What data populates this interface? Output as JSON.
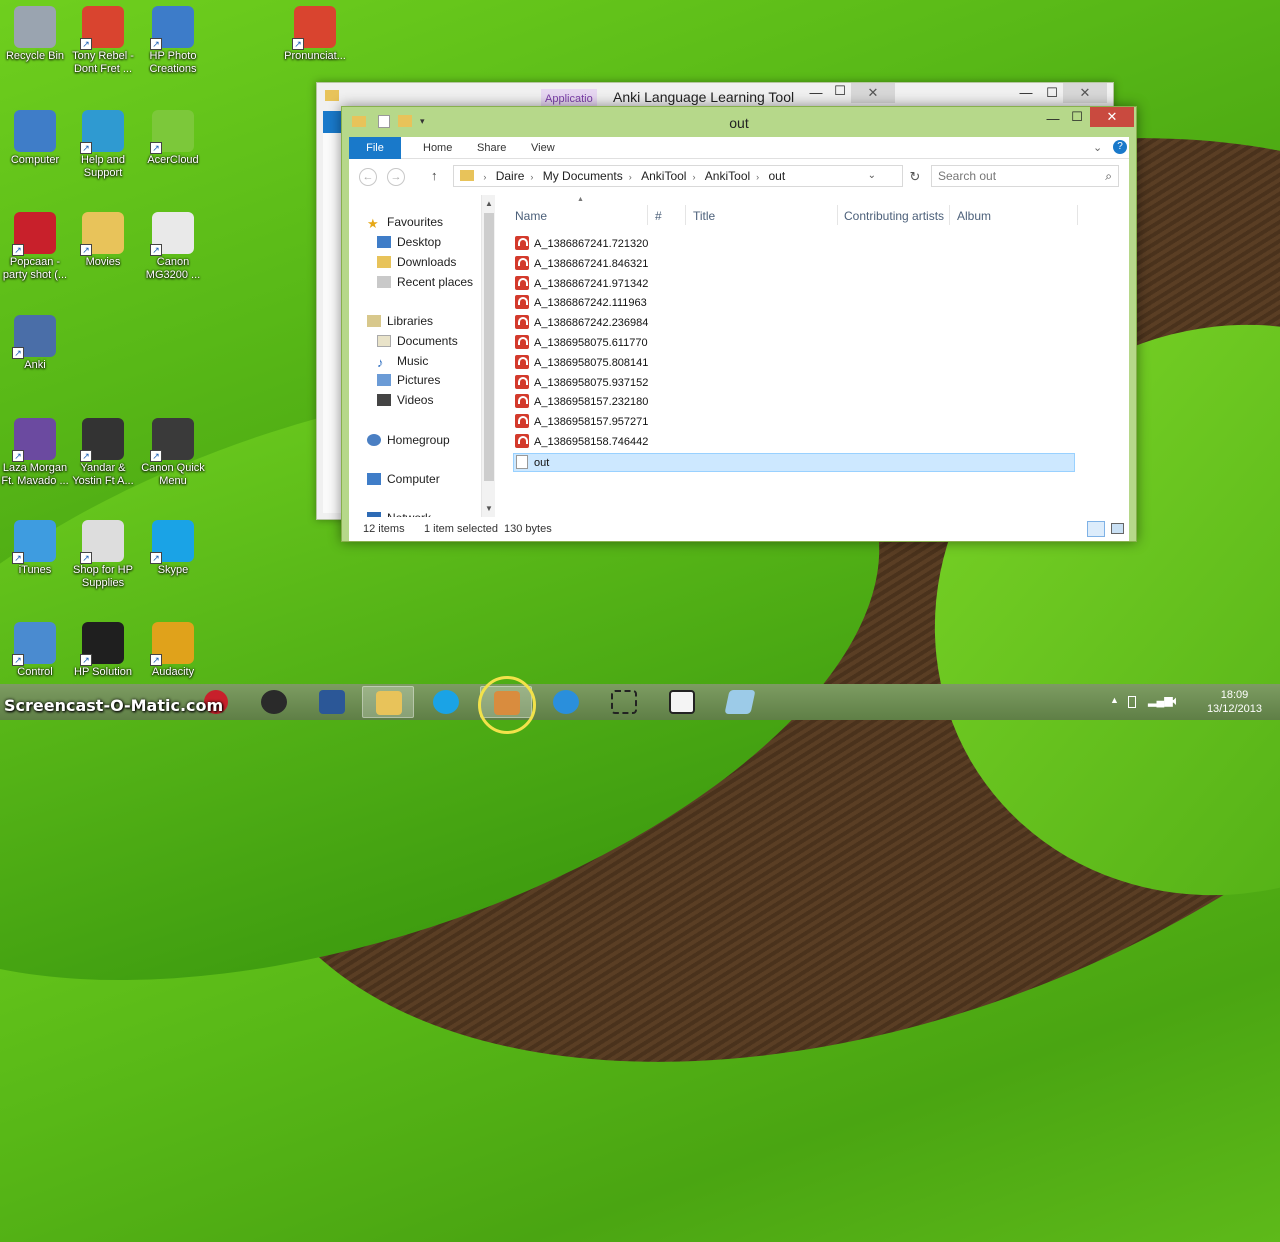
{
  "desktop": {
    "icons": [
      {
        "label": "Recycle Bin",
        "icon": "recycle-bin-icon",
        "color": "#9aa4b0"
      },
      {
        "label": "Tony Rebel - Dont Fret ...",
        "icon": "headphones-icon",
        "color": "#d9442f"
      },
      {
        "label": "HP Photo Creations",
        "icon": "photo-icon",
        "color": "#3d7cc9"
      },
      {
        "label": "Pronunciat...",
        "icon": "headphones-icon",
        "color": "#d9442f"
      },
      {
        "label": "Computer",
        "icon": "computer-icon",
        "color": "#3f7dc8"
      },
      {
        "label": "Help and Support",
        "icon": "help-icon",
        "color": "#2f9ad1"
      },
      {
        "label": "AcerCloud",
        "icon": "cloud-icon",
        "color": "#7cc83a"
      },
      {
        "label": "Popcaan - party shot (...",
        "icon": "media-icon",
        "color": "#c8202b"
      },
      {
        "label": "Movies",
        "icon": "folder-icon",
        "color": "#e8c35a"
      },
      {
        "label": "Canon MG3200 ...",
        "icon": "document-help-icon",
        "color": "#e9e9e9"
      },
      {
        "label": "Anki",
        "icon": "anki-icon",
        "color": "#4a6ea8"
      },
      {
        "label": "Laza Morgan Ft. Mavado ...",
        "icon": "media-icon",
        "color": "#6b4aa0"
      },
      {
        "label": "Yandar & Yostin Ft A...",
        "icon": "media-icon",
        "color": "#333333"
      },
      {
        "label": "Canon Quick Menu",
        "icon": "star-icon",
        "color": "#3a3a3a"
      },
      {
        "label": "iTunes",
        "icon": "itunes-icon",
        "color": "#3e9ce0"
      },
      {
        "label": "Shop for HP Supplies",
        "icon": "printer-icon",
        "color": "#dddddd"
      },
      {
        "label": "Skype",
        "icon": "skype-icon",
        "color": "#1aa3e6"
      },
      {
        "label": "Control",
        "icon": "control-panel-icon",
        "color": "#4a8bd0"
      },
      {
        "label": "HP Solution",
        "icon": "hp-icon",
        "color": "#1f1f1f"
      },
      {
        "label": "Audacity",
        "icon": "audacity-icon",
        "color": "#e0a21b"
      }
    ]
  },
  "back_window": {
    "tab_label": "Applicatio",
    "title": "Anki Language Learning Tool",
    "minimize": "—",
    "maximize": "☐",
    "close": "✕"
  },
  "window": {
    "title": "out",
    "minimize": "—",
    "maximize": "☐",
    "close": "✕",
    "tabs": [
      "File",
      "Home",
      "Share",
      "View"
    ],
    "breadcrumb": [
      "Daire",
      "My Documents",
      "AnkiTool",
      "AnkiTool",
      "out"
    ],
    "search_placeholder": "Search out",
    "nav": {
      "favourites": "Favourites",
      "desktop": "Desktop",
      "downloads": "Downloads",
      "recent": "Recent places",
      "libraries": "Libraries",
      "documents": "Documents",
      "music": "Music",
      "pictures": "Pictures",
      "videos": "Videos",
      "homegroup": "Homegroup",
      "computer": "Computer",
      "network": "Network"
    },
    "columns": [
      "Name",
      "#",
      "Title",
      "Contributing artists",
      "Album"
    ],
    "files": [
      "A_1386867241.721320",
      "A_1386867241.846321",
      "A_1386867241.971342",
      "A_1386867242.111963",
      "A_1386867242.236984",
      "A_1386958075.611770",
      "A_1386958075.808141",
      "A_1386958075.937152",
      "A_1386958157.232180",
      "A_1386958157.957271",
      "A_1386958158.746442"
    ],
    "selected_file": "out",
    "status": {
      "count": "12 items",
      "selected": "1 item selected",
      "size": "130 bytes"
    }
  },
  "taskbar": {
    "time": "18:09",
    "date": "13/12/2013"
  },
  "watermark": "Screencast-O-Matic.com"
}
